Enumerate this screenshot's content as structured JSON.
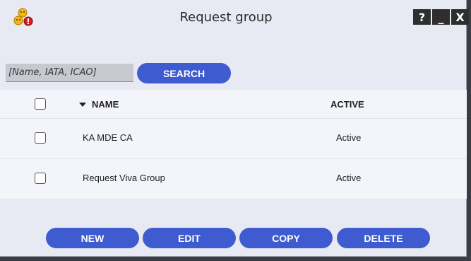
{
  "window": {
    "title": "Request group",
    "help_glyph": "?",
    "minimize_glyph": "_",
    "close_glyph": "X"
  },
  "search": {
    "placeholder": "[Name, IATA, ICAO]",
    "button_label": "SEARCH"
  },
  "table": {
    "columns": {
      "name": "NAME",
      "active": "ACTIVE"
    },
    "rows": [
      {
        "name": "KA MDE CA",
        "active": "Active"
      },
      {
        "name": "Request Viva Group",
        "active": "Active"
      }
    ]
  },
  "footer": {
    "new_label": "NEW",
    "edit_label": "EDIT",
    "copy_label": "COPY",
    "delete_label": "DELETE"
  },
  "colors": {
    "accent": "#3f5bd0",
    "window_bg": "#e8eaf3",
    "table_bg": "#f4f5fa"
  }
}
